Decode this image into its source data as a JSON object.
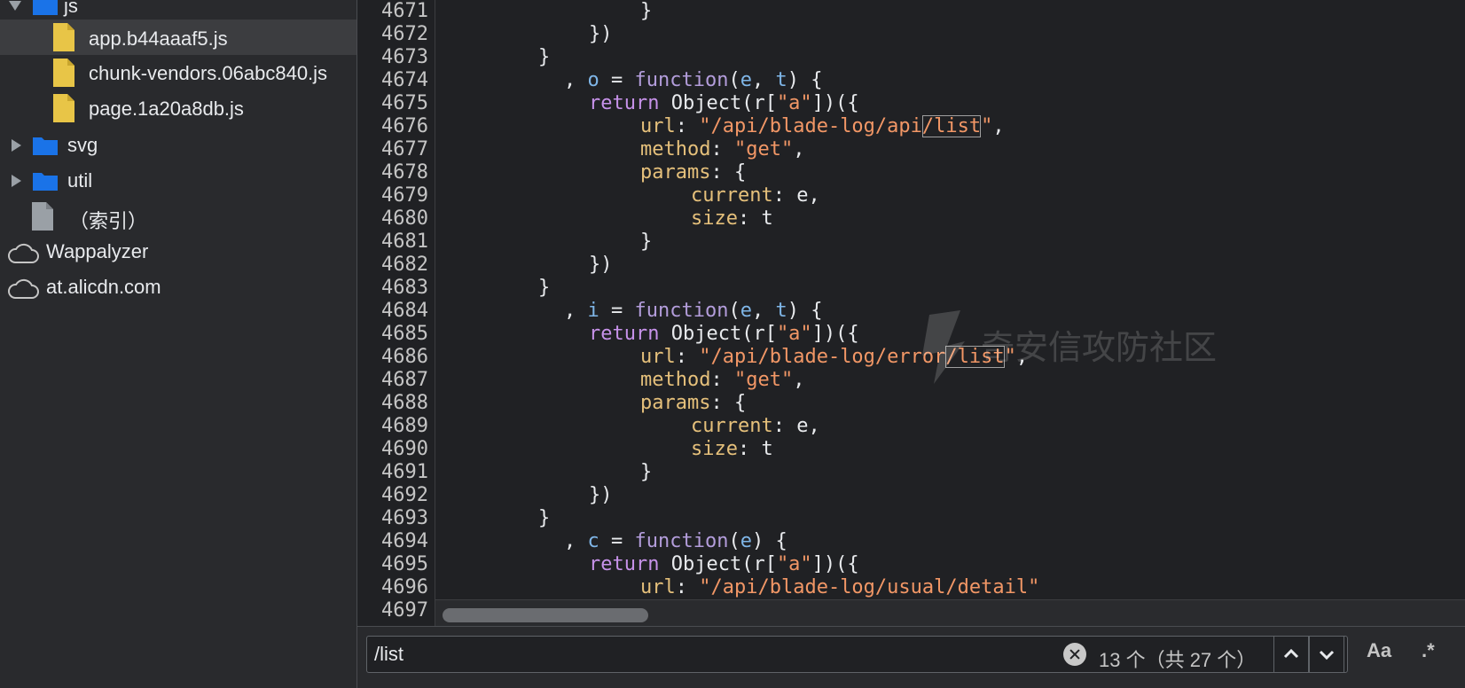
{
  "sidebar": {
    "items": [
      {
        "label": "js",
        "kind": "folder",
        "expanded": true
      },
      {
        "label": "app.b44aaaf5.js",
        "kind": "file",
        "selected": true
      },
      {
        "label": "chunk-vendors.06abc840.js",
        "kind": "file"
      },
      {
        "label": "page.1a20a8db.js",
        "kind": "file"
      },
      {
        "label": "svg",
        "kind": "folder",
        "expanded": false
      },
      {
        "label": "util",
        "kind": "folder",
        "expanded": false
      },
      {
        "label": "（索引）",
        "kind": "file-generic"
      },
      {
        "label": "Wappalyzer",
        "kind": "cloud"
      },
      {
        "label": "at.alicdn.com",
        "kind": "cloud"
      }
    ]
  },
  "editor": {
    "line_numbers": [
      "4671",
      "4672",
      "4673",
      "4674",
      "4675",
      "4676",
      "4677",
      "4678",
      "4679",
      "4680",
      "4681",
      "4682",
      "4683",
      "4684",
      "4685",
      "4686",
      "4687",
      "4688",
      "4689",
      "4690",
      "4691",
      "4692",
      "4693",
      "4694",
      "4695",
      "4696",
      "4697"
    ],
    "tokens": {
      "close_brace": "}",
      "close_paren_brace": "})",
      "comma": ",",
      "o": "o",
      "i": "i",
      "c": "c",
      "eq": " = ",
      "function": "function",
      "args_et_open": "(",
      "e": "e",
      "t": "t",
      "args_sep": ", ",
      "args_close_brace": ") {",
      "return": "return",
      "object_call_a": " Object(r[",
      "a_str": "\"a\"",
      "object_call_b": "])({",
      "url": "url",
      "colon": ": ",
      "url_api_pre": "\"/api/blade-log/api",
      "url_error_pre": "\"/api/blade-log/error",
      "list_match": "/list",
      "quote": "\"",
      "url_usual": "\"/api/blade-log/usual/detail\"",
      "method": "method",
      "get_str": "\"get\"",
      "params": "params",
      "open_brace": ": {",
      "current": "current",
      "e_comma": "e,",
      "size": "size",
      "t_val": "t"
    }
  },
  "search": {
    "query": "/list",
    "match_count": "13 个（共 27 个）",
    "case_label": "Aa",
    "regex_label": ".*"
  },
  "watermark": {
    "text": "奇安信攻防社区"
  }
}
